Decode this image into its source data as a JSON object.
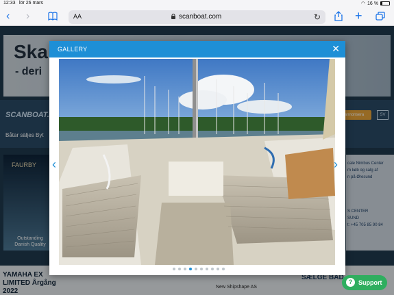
{
  "status": {
    "time": "12:33",
    "date": "lör 26 mars",
    "battery": "16 %"
  },
  "browser": {
    "text_size_button": "AA",
    "url": "scanboat.com"
  },
  "background_page": {
    "hero_title": "Ska",
    "hero_subtitle": "- deri",
    "logo": "SCANBOAT.COM",
    "nav_link": "Båtar säljes",
    "nav_link_2": "Byt",
    "annonsera_button": "annonsera",
    "language": "SV",
    "left_ad_brand": "FAURBY",
    "left_ad_caption": "Outstanding Danish Quality",
    "bottom_title": "YAMAHA EX LIMITED Årgång 2022",
    "new_listing": "New Shipshape AS",
    "right_ad": "SÆLGE BAD",
    "right_ad_lines": [
      "cale Nimbus Center",
      "m køb og salg af",
      "n på Øresund",
      "S CENTER",
      "SUND",
      "t: +45 705 85 90 84"
    ]
  },
  "gallery": {
    "title": "GALLERY",
    "close_icon": "close-icon",
    "prev_icon": "chevron-left-icon",
    "next_icon": "chevron-right-icon",
    "total_images": 10,
    "active_index": 3,
    "accent_color": "#1e8fd6"
  },
  "support_button": {
    "label": "Support",
    "color": "#2fae5f"
  }
}
